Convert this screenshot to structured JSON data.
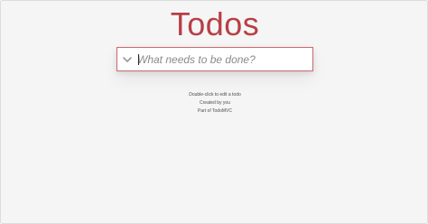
{
  "header": {
    "title": "Todos"
  },
  "new_todo": {
    "value": "",
    "placeholder": "What needs to be done?",
    "toggle_icon": "chevron-down-icon"
  },
  "info": {
    "edit_hint": "Double-click to edit a todo",
    "credit": "Created by you",
    "part_of": "Part of TodoMVC"
  },
  "colors": {
    "title": "#b83f45",
    "background": "#f5f5f5",
    "input_border": "#c96a6f"
  }
}
